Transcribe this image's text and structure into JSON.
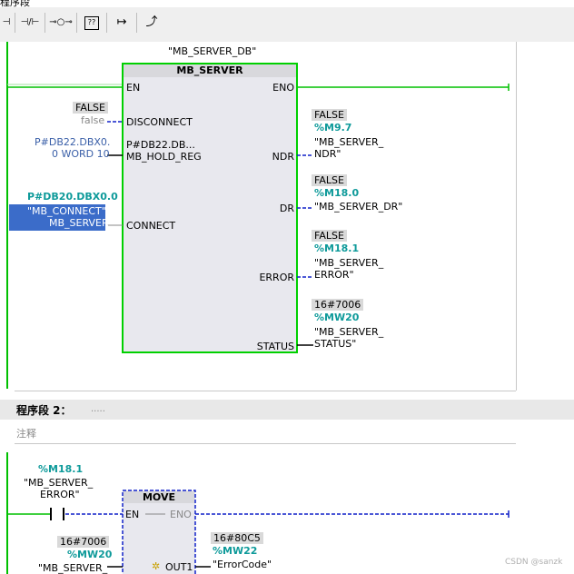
{
  "top_clip_text": "程序段",
  "toolbar": {
    "items": [
      "⊣",
      "⊣/⊢",
      "⊸○⊸",
      "??",
      "↦",
      "⤴"
    ]
  },
  "block1": {
    "instance_db": "\"MB_SERVER_DB\"",
    "title": "MB_SERVER",
    "inputs": {
      "en": "EN",
      "disconnect": "DISCONNECT",
      "mb_hold_reg": "MB_HOLD_REG",
      "connect": "CONNECT",
      "hold_reg_inside": "P#DB22.DB..."
    },
    "outputs": {
      "eno": "ENO",
      "ndr": "NDR",
      "dr": "DR",
      "error": "ERROR",
      "status": "STATUS"
    },
    "disconnect_value": "FALSE",
    "disconnect_param": "false",
    "hold_reg_param_line1": "P#DB22.DBX0.",
    "hold_reg_param_line2": "0 WORD 10",
    "connect_addr": "P#DB20.DBX0.0",
    "connect_sym_line1": "\"MB_CONNECT\".",
    "connect_sym_line2": "MB_SERVER",
    "ndr_value": "FALSE",
    "ndr_addr": "%M9.7",
    "ndr_sym_line1": "\"MB_SERVER_",
    "ndr_sym_line2": "NDR\"",
    "dr_value": "FALSE",
    "dr_addr": "%M18.0",
    "dr_sym": "\"MB_SERVER_DR\"",
    "error_value": "FALSE",
    "error_addr": "%M18.1",
    "error_sym_line1": "\"MB_SERVER_",
    "error_sym_line2": "ERROR\"",
    "status_value": "16#7006",
    "status_addr": "%MW20",
    "status_sym_line1": "\"MB_SERVER_",
    "status_sym_line2": "STATUS\""
  },
  "network2": {
    "title": "程序段 2：",
    "title_dots": ".....",
    "comment": "注释",
    "contact_addr": "%M18.1",
    "contact_sym_line1": "\"MB_SERVER_",
    "contact_sym_line2": "ERROR\"",
    "move_title": "MOVE",
    "en": "EN",
    "eno": "ENO",
    "out1": "OUT1",
    "in_value": "16#7006",
    "in_addr": "%MW20",
    "in_sym": "\"MB_SERVER_",
    "out_value": "16#80C5",
    "out_addr": "%MW22",
    "out_sym": "\"ErrorCode\""
  },
  "watermark": "CSDN @sanzk",
  "colors": {
    "green": "#00d000",
    "blue": "#1020c8",
    "teal": "#0e9a9a",
    "param_blue": "#3a5fa8",
    "select_bg": "#3b6cc9"
  }
}
